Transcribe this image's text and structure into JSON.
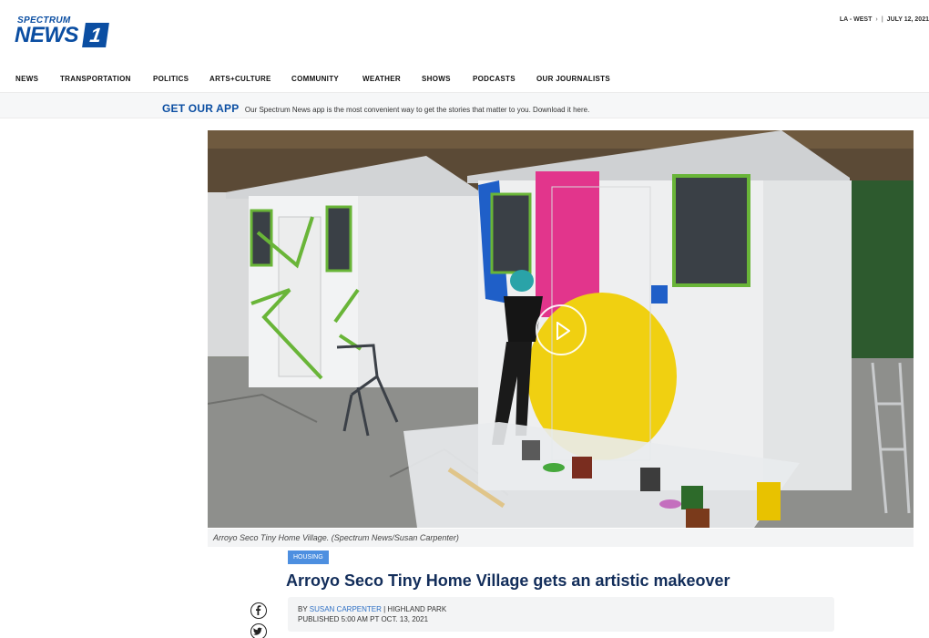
{
  "logo": {
    "line1": "SPECTRUM",
    "line2": "NEWS",
    "mark": "1"
  },
  "region": {
    "location": "LA - WEST",
    "chevron": "›",
    "separator": "|",
    "date": "JULY 12, 2021"
  },
  "nav": {
    "items": [
      "NEWS",
      "TRANSPORTATION",
      "POLITICS",
      "ARTS+CULTURE",
      "COMMUNITY",
      "WEATHER",
      "SHOWS",
      "PODCASTS",
      "OUR JOURNALISTS"
    ]
  },
  "app_banner": {
    "cta": "GET OUR APP",
    "message": "Our Spectrum News app is the most convenient way to get the stories that matter to you. Download it here."
  },
  "media": {
    "caption": "Arroyo Seco Tiny Home Village. (Spectrum News/Susan Carpenter)",
    "play_icon": "play-icon"
  },
  "article": {
    "tag": "HOUSING",
    "headline": "Arroyo Seco Tiny Home Village gets an artistic makeover",
    "by_prefix": "BY",
    "author": "SUSAN CARPENTER",
    "location_text": " | HIGHLAND PARK",
    "published": "PUBLISHED 5:00 AM PT OCT. 13, 2021"
  },
  "share": {
    "icons": [
      "facebook-icon",
      "twitter-icon"
    ]
  },
  "colors": {
    "brand_blue": "#0b4ea2",
    "headline_navy": "#122d5a",
    "tag_blue": "#4d8fe0",
    "link_blue": "#2d6fc4"
  }
}
